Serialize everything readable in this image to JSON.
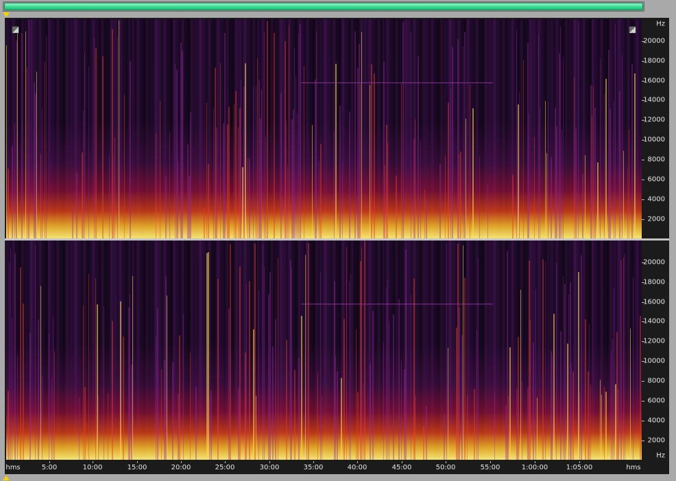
{
  "colors": {
    "background": "#a9a9a9",
    "display": "#1b1b1b",
    "scroll_thumb": "#38dc91",
    "marker": "#f5d300",
    "spectrogram_low": "#12081a",
    "spectrogram_mid": "#b4143c",
    "spectrogram_high": "#fff078"
  },
  "icons": {
    "zoom_left": "zoom-corner-icon",
    "zoom_right": "zoom-corner-icon",
    "marker_top": "playhead-marker-icon",
    "marker_bottom": "playhead-marker-icon"
  },
  "scrollbar": {
    "position": 0.0,
    "visible_fraction": 1.0
  },
  "spectrogram": {
    "channels": [
      {
        "frequency_axis": {
          "unit_label": "Hz",
          "tick_labels": [
            "20000",
            "18000",
            "16000",
            "14000",
            "12000",
            "10000",
            "8000",
            "6000",
            "4000",
            "2000"
          ]
        }
      },
      {
        "frequency_axis": {
          "unit_label": "Hz",
          "tick_labels": [
            "20000",
            "18000",
            "16000",
            "14000",
            "12000",
            "10000",
            "8000",
            "6000",
            "4000",
            "2000"
          ]
        }
      }
    ],
    "time_axis": {
      "unit_label_left": "hms",
      "unit_label_right": "hms",
      "tick_labels": [
        "5:00",
        "10:00",
        "15:00",
        "20:00",
        "25:00",
        "30:00",
        "35:00",
        "40:00",
        "45:00",
        "50:00",
        "55:00",
        "1:00:00",
        "1:05:00"
      ]
    }
  }
}
